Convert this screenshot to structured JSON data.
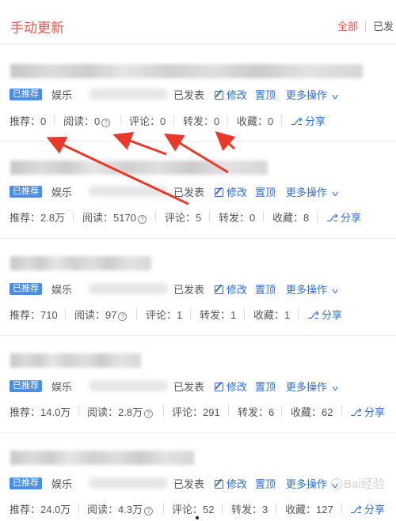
{
  "header": {
    "title": "手动更新",
    "filter_all": "全部",
    "filter_published": "已发"
  },
  "articles": [
    {
      "tag": "已推荐",
      "category": "娱乐",
      "status": "已发表",
      "actions": {
        "edit": "修改",
        "pin": "置顶",
        "more": "更多操作"
      },
      "stats": {
        "recommend": "推荐：0",
        "reads": "阅读：0",
        "comments": "评论：0",
        "reposts": "转发：0",
        "favorites": "收藏：0",
        "share": "分享"
      }
    },
    {
      "tag": "已推荐",
      "category": "娱乐",
      "status": "已发表",
      "actions": {
        "edit": "修改",
        "pin": "置顶",
        "more": "更多操作"
      },
      "stats": {
        "recommend": "推荐：2.8万",
        "reads": "阅读：5170",
        "comments": "评论：5",
        "reposts": "转发：0",
        "favorites": "收藏：8",
        "share": "分享"
      }
    },
    {
      "tag": "已推荐",
      "category": "娱乐",
      "status": "已发表",
      "actions": {
        "edit": "修改",
        "pin": "置顶",
        "more": "更多操作"
      },
      "stats": {
        "recommend": "推荐：710",
        "reads": "阅读：97",
        "comments": "评论：1",
        "reposts": "转发：1",
        "favorites": "收藏：1",
        "share": "分享"
      }
    },
    {
      "tag": "已推荐",
      "category": "娱乐",
      "status": "已发表",
      "actions": {
        "edit": "修改",
        "pin": "置顶",
        "more": "更多操作"
      },
      "stats": {
        "recommend": "推荐：14.0万",
        "reads": "阅读：2.8万",
        "comments": "评论：291",
        "reposts": "转发：6",
        "favorites": "收藏：62",
        "share": "分享"
      }
    },
    {
      "tag": "已推荐",
      "category": "娱乐",
      "status": "已发表",
      "actions": {
        "edit": "修改",
        "pin": "置顶",
        "more": "更多操作"
      },
      "stats": {
        "recommend": "推荐：24.0万",
        "reads": "阅读：4.3万",
        "comments": "评论：52",
        "reposts": "转发：3",
        "favorites": "收藏：127",
        "share": "分享"
      }
    }
  ],
  "watermark": "Bai经验",
  "colors": {
    "accent_red": "#f0554a",
    "link_blue": "#2c6ed8",
    "tag_blue": "#4a8fe7",
    "arrow_red": "#e8392b"
  },
  "icons": [
    "edit-icon",
    "chevron-down-icon",
    "help-icon",
    "share-icon"
  ]
}
